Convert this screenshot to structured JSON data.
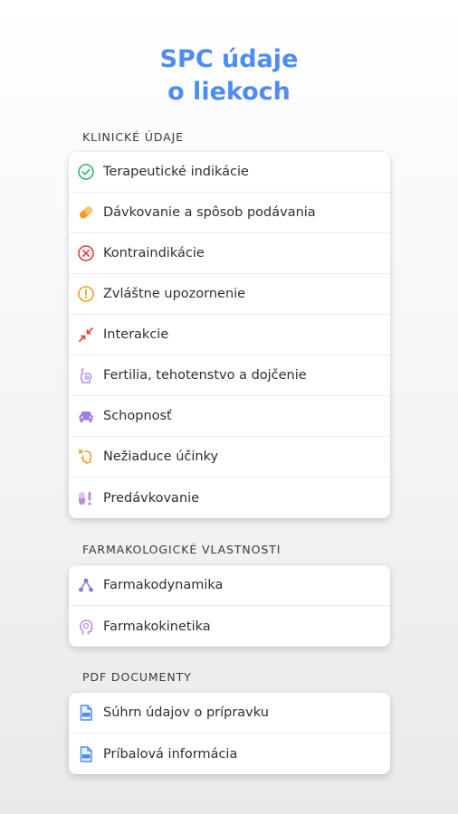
{
  "title": {
    "line1": "SPC údaje",
    "line2": "o liekoch"
  },
  "sections": [
    {
      "header": "KLINICKÉ ÚDAJE",
      "items": [
        {
          "label": "Terapeutické indikácie",
          "icon": "check-circle-icon",
          "color": "#2fb56a"
        },
        {
          "label": "Dávkovanie a spôsob podávania",
          "icon": "pill-icon",
          "color": "#f59a23"
        },
        {
          "label": "Kontraindikácie",
          "icon": "x-circle-icon",
          "color": "#e53935"
        },
        {
          "label": "Zvláštne upozornenie",
          "icon": "exclamation-circle-icon",
          "color": "#f59a23"
        },
        {
          "label": "Interakcie",
          "icon": "arrows-inward-icon",
          "color": "#e53935"
        },
        {
          "label": "Fertilia, tehotenstvo a dojčenie",
          "icon": "pregnancy-icon",
          "color": "#b78be6"
        },
        {
          "label": "Schopnosť",
          "icon": "car-icon",
          "color": "#9a7fe0"
        },
        {
          "label": "Nežiaduce účinky",
          "icon": "adverse-effect-icon",
          "color": "#f59a23"
        },
        {
          "label": "Predávkovanie",
          "icon": "overdose-icon",
          "color": "#b78be6"
        }
      ]
    },
    {
      "header": "FARMAKOLOGICKÉ VLASTNOSTI",
      "items": [
        {
          "label": "Farmakodynamika",
          "icon": "molecule-icon",
          "color": "#8a78d0"
        },
        {
          "label": "Farmakokinetika",
          "icon": "head-icon",
          "color": "#b78be6"
        }
      ]
    },
    {
      "header": "PDF DOCUMENTY",
      "items": [
        {
          "label": "Súhrn údajov o prípravku",
          "icon": "pdf-file-icon",
          "color": "#4d8cf5"
        },
        {
          "label": "Príbalová informácia",
          "icon": "pdf-file-icon",
          "color": "#4d8cf5"
        }
      ]
    }
  ]
}
